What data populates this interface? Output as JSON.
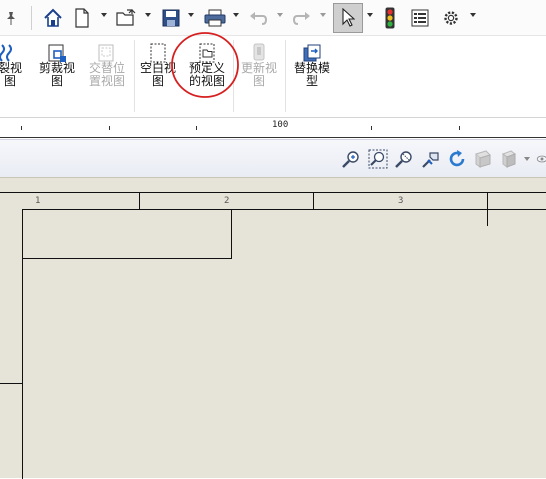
{
  "ribbon": {
    "buttons": [
      {
        "label": "裂视\n图",
        "enabled": true
      },
      {
        "label": "剪裁视\n图",
        "enabled": true
      },
      {
        "label": "交替位\n置视图",
        "enabled": false
      },
      {
        "label": "空白视\n图",
        "enabled": true
      },
      {
        "label": "预定义\n的视图",
        "enabled": true,
        "highlighted": true
      },
      {
        "label": "更新视\n图",
        "enabled": false
      },
      {
        "label": "替换模\n型",
        "enabled": true
      }
    ]
  },
  "ruler": {
    "label": "100"
  },
  "sheet": {
    "zone_labels": [
      "1",
      "2",
      "3"
    ]
  },
  "colors": {
    "sheet_bg": "#e6e4d8",
    "highlight_circle": "#d62020",
    "accent_blue": "#1f5fbf"
  },
  "icons": {
    "quick_access": [
      "pin-icon",
      "home-icon",
      "new-file-icon",
      "open-folder-icon",
      "save-icon",
      "print-icon",
      "undo-icon",
      "redo-icon",
      "select-cursor-icon",
      "traffic-light-icon",
      "file-properties-icon",
      "options-gear-icon"
    ],
    "view_toolbar": [
      "zoom-to-fit-icon",
      "zoom-to-area-icon",
      "zoom-in-out-icon",
      "zoom-to-selection-icon",
      "rotate-view-icon",
      "section-view-icon",
      "display-style-icon"
    ]
  }
}
